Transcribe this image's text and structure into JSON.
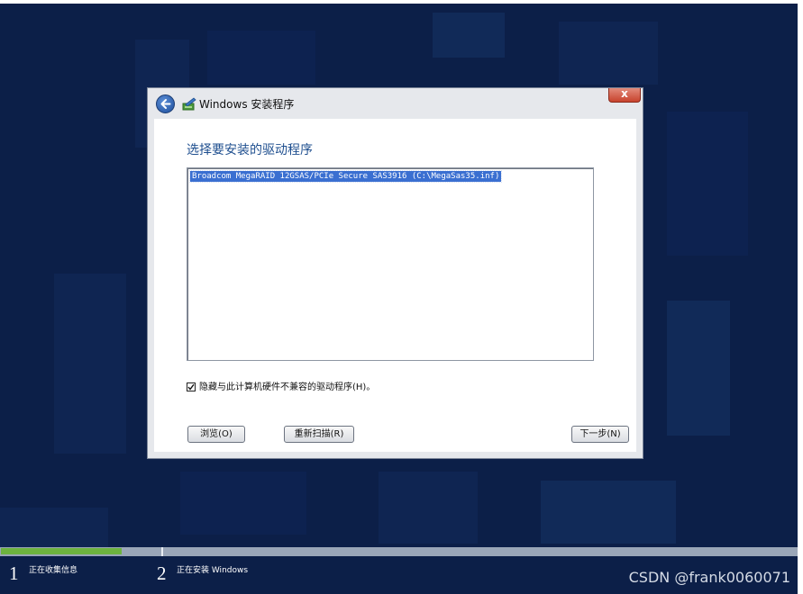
{
  "window": {
    "title": "Windows 安装程序",
    "close_label": "x"
  },
  "page": {
    "heading": "选择要安装的驱动程序",
    "drivers": [
      "Broadcom  MegaRAID 12GSAS/PCIe Secure SAS3916 (C:\\MegaSas35.inf)"
    ],
    "hide_incompatible": {
      "checked": true,
      "label": "隐藏与此计算机硬件不兼容的驱动程序(H)。"
    }
  },
  "buttons": {
    "browse": "浏览(O)",
    "rescan": "重新扫描(R)",
    "next": "下一步(N)"
  },
  "progress": {
    "fraction": 0.152,
    "steps": [
      {
        "number": "1",
        "label": "正在收集信息"
      },
      {
        "number": "2",
        "label": "正在安装 Windows"
      }
    ]
  },
  "watermark": "CSDN @frank0060071",
  "colors": {
    "background": "#0c1f48",
    "heading": "#1f4f8f",
    "selection": "#3a6fd1",
    "progress": "#6db33f"
  },
  "icons": {
    "back": "back-arrow-icon",
    "app": "windows-setup-icon",
    "close": "close-icon",
    "checkbox": "checkmark-icon"
  }
}
